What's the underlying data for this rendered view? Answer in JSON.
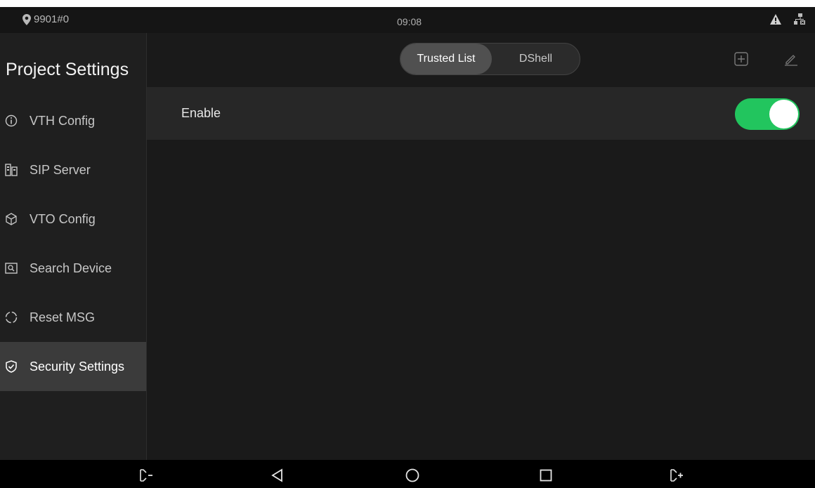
{
  "status": {
    "location": "9901#0",
    "time": "09:08",
    "icons": [
      "warning-icon",
      "network-icon"
    ]
  },
  "sidebar": {
    "title": "Project Settings",
    "items": [
      {
        "label": "VTH Config",
        "icon": "info-icon"
      },
      {
        "label": "SIP Server",
        "icon": "server-icon"
      },
      {
        "label": "VTO Config",
        "icon": "cube-icon"
      },
      {
        "label": "Search Device",
        "icon": "search-device-icon"
      },
      {
        "label": "Reset MSG",
        "icon": "reset-icon"
      },
      {
        "label": "Security Settings",
        "icon": "shield-check-icon",
        "active": true
      }
    ]
  },
  "main": {
    "tabs": [
      {
        "label": "Trusted List",
        "active": true
      },
      {
        "label": "DShell",
        "active": false
      }
    ],
    "toolbar": [
      "add-icon",
      "edit-icon"
    ],
    "enable_row": {
      "label": "Enable",
      "on": true
    }
  },
  "navbar": [
    "volume-down-icon",
    "back-icon",
    "home-icon",
    "recents-icon",
    "volume-up-icon"
  ],
  "colors": {
    "accent": "#22c55e",
    "background": "#1a1a1a",
    "sidebar_active": "#3b3b3b"
  }
}
